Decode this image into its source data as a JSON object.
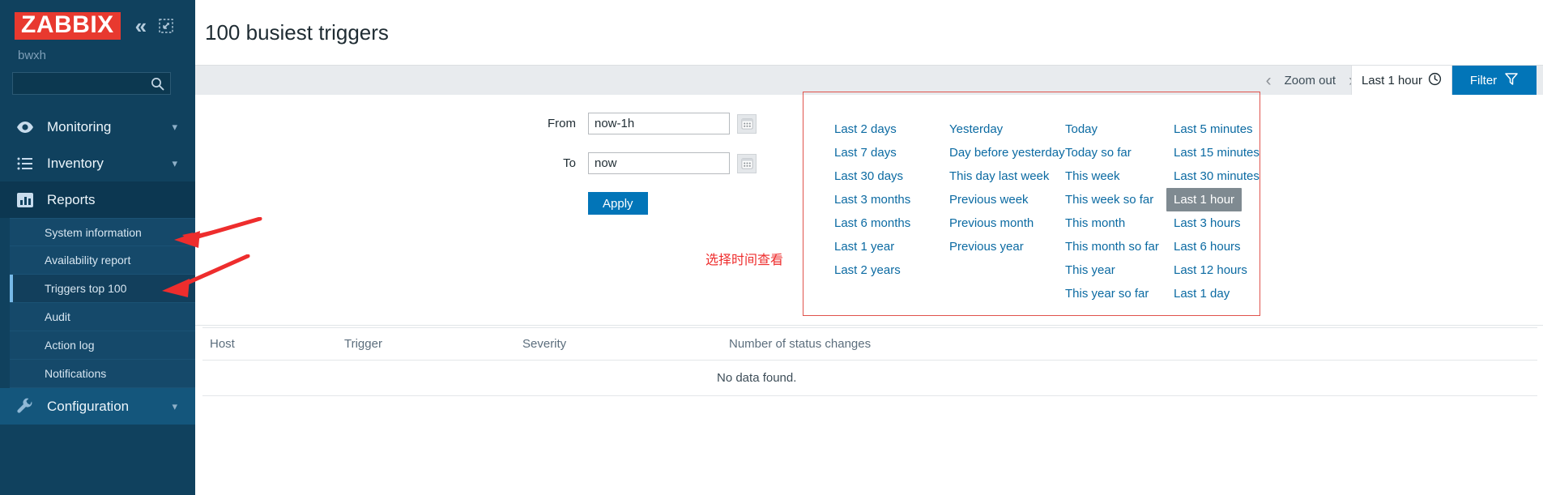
{
  "sidebar": {
    "logo": "ZABBIX",
    "collapse_icon": "chevron-double-left-icon",
    "expand_icon": "expand-icon",
    "user": "bwxh",
    "search": {
      "value": "",
      "placeholder": ""
    },
    "menu": [
      {
        "label": "Monitoring",
        "icon": "eye-icon",
        "has_chevron": true
      },
      {
        "label": "Inventory",
        "icon": "list-icon",
        "has_chevron": true
      },
      {
        "label": "Reports",
        "icon": "bar-chart-icon",
        "has_chevron": false,
        "active": true
      },
      {
        "label": "Configuration",
        "icon": "wrench-icon",
        "has_chevron": true
      }
    ],
    "reports_submenu": [
      {
        "label": "System information"
      },
      {
        "label": "Availability report"
      },
      {
        "label": "Triggers top 100",
        "selected": true
      },
      {
        "label": "Audit"
      },
      {
        "label": "Action log"
      },
      {
        "label": "Notifications"
      }
    ]
  },
  "header": {
    "title": "100 busiest triggers"
  },
  "filter_bar": {
    "prev_arrow": "chevron-left-icon",
    "zoom_out_label": "Zoom out",
    "next_arrow": "chevron-right-icon",
    "time_tab_label": "Last 1 hour",
    "time_tab_icon": "clock-icon",
    "filter_tab_label": "Filter",
    "filter_tab_icon": "funnel-icon",
    "filter_tab_color": "#0275b8"
  },
  "time_form": {
    "from_label": "From",
    "from_value": "now-1h",
    "to_label": "To",
    "to_value": "now",
    "calendar_icon": "calendar-icon",
    "apply_label": "Apply"
  },
  "annotation": {
    "note_text": "选择时间查看",
    "note_color": "#ee2d2d",
    "arrow_color": "#ee2d2d"
  },
  "quick_ranges": {
    "border_color": "#e0534c",
    "selected": "Last 1 hour",
    "columns": [
      [
        "Last 2 days",
        "Last 7 days",
        "Last 30 days",
        "Last 3 months",
        "Last 6 months",
        "Last 1 year",
        "Last 2 years"
      ],
      [
        "Yesterday",
        "Day before yesterday",
        "This day last week",
        "Previous week",
        "Previous month",
        "Previous year",
        ""
      ],
      [
        "Today",
        "Today so far",
        "This week",
        "This week so far",
        "This month",
        "This month so far",
        "This year",
        "This year so far"
      ],
      [
        "Last 5 minutes",
        "Last 15 minutes",
        "Last 30 minutes",
        "Last 1 hour",
        "Last 3 hours",
        "Last 6 hours",
        "Last 12 hours",
        "Last 1 day"
      ]
    ]
  },
  "table": {
    "headers": [
      "Host",
      "Trigger",
      "Severity",
      "Number of status changes"
    ],
    "empty_message": "No data found.",
    "rows": []
  }
}
